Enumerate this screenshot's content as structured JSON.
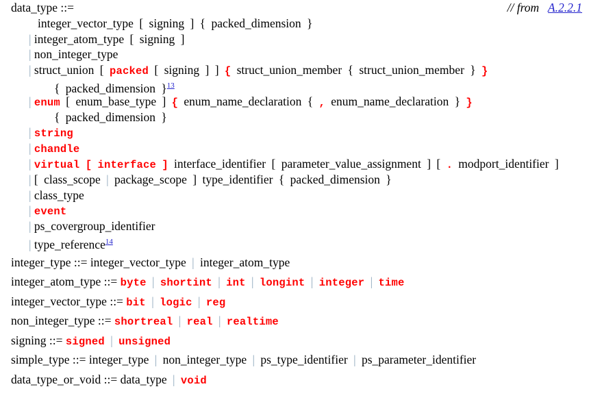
{
  "document": {
    "type": "bnf-grammar",
    "background": "#ffffff",
    "colors": {
      "keyword": "#ff0000",
      "nonterminal": "#000000",
      "alternation_bar": "#8fa8bc",
      "link": "#2222cc"
    }
  },
  "header_note": {
    "comment": "// from",
    "xref": "A.2.2.1"
  },
  "productions": [
    {
      "lhs": "data_type",
      "assign": "::=",
      "alternatives": [
        {
          "bar": "",
          "indent": "first",
          "tokens": [
            {
              "t": "nt",
              "v": "integer_vector_type"
            },
            {
              "t": "meta",
              "v": "["
            },
            {
              "t": "nt",
              "v": "signing"
            },
            {
              "t": "meta",
              "v": "]"
            },
            {
              "t": "meta",
              "v": "{"
            },
            {
              "t": "nt",
              "v": "packed_dimension"
            },
            {
              "t": "meta",
              "v": "}"
            }
          ]
        },
        {
          "bar": "|",
          "indent": "alt",
          "tokens": [
            {
              "t": "nt",
              "v": "integer_atom_type"
            },
            {
              "t": "meta",
              "v": "["
            },
            {
              "t": "nt",
              "v": "signing"
            },
            {
              "t": "meta",
              "v": "]"
            }
          ]
        },
        {
          "bar": "|",
          "indent": "alt",
          "tokens": [
            {
              "t": "nt",
              "v": "non_integer_type"
            }
          ]
        },
        {
          "bar": "|",
          "indent": "alt",
          "tokens": [
            {
              "t": "nt",
              "v": "struct_union"
            },
            {
              "t": "meta",
              "v": "["
            },
            {
              "t": "kw",
              "v": "packed"
            },
            {
              "t": "meta",
              "v": "["
            },
            {
              "t": "nt",
              "v": "signing"
            },
            {
              "t": "meta",
              "v": "]"
            },
            {
              "t": "meta",
              "v": "]"
            },
            {
              "t": "term",
              "v": "{"
            },
            {
              "t": "nt",
              "v": "struct_union_member"
            },
            {
              "t": "meta",
              "v": "{"
            },
            {
              "t": "nt",
              "v": "struct_union_member"
            },
            {
              "t": "meta",
              "v": "}"
            },
            {
              "t": "term",
              "v": "}"
            }
          ]
        },
        {
          "bar": "",
          "indent": "cont",
          "tokens": [
            {
              "t": "meta",
              "v": "{"
            },
            {
              "t": "nt",
              "v": "packed_dimension"
            },
            {
              "t": "meta",
              "v": "}"
            },
            {
              "t": "fn",
              "v": "13"
            }
          ]
        },
        {
          "bar": "|",
          "indent": "alt",
          "tokens": [
            {
              "t": "kw",
              "v": "enum"
            },
            {
              "t": "meta",
              "v": "["
            },
            {
              "t": "nt",
              "v": "enum_base_type"
            },
            {
              "t": "meta",
              "v": "]"
            },
            {
              "t": "term",
              "v": "{"
            },
            {
              "t": "nt",
              "v": "enum_name_declaration"
            },
            {
              "t": "meta",
              "v": "{"
            },
            {
              "t": "term",
              "v": ","
            },
            {
              "t": "nt",
              "v": "enum_name_declaration"
            },
            {
              "t": "meta",
              "v": "}"
            },
            {
              "t": "term",
              "v": "}"
            }
          ]
        },
        {
          "bar": "",
          "indent": "cont",
          "tokens": [
            {
              "t": "meta",
              "v": "{"
            },
            {
              "t": "nt",
              "v": "packed_dimension"
            },
            {
              "t": "meta",
              "v": "}"
            }
          ]
        },
        {
          "bar": "|",
          "indent": "alt",
          "tokens": [
            {
              "t": "kw",
              "v": "string"
            }
          ]
        },
        {
          "bar": "|",
          "indent": "alt",
          "tokens": [
            {
              "t": "kw",
              "v": "chandle"
            }
          ]
        },
        {
          "bar": "|",
          "indent": "alt",
          "tokens": [
            {
              "t": "kw",
              "v": "virtual"
            },
            {
              "t": "term",
              "v": "["
            },
            {
              "t": "kw",
              "v": "interface"
            },
            {
              "t": "term",
              "v": "]"
            },
            {
              "t": "nt",
              "v": "interface_identifier"
            },
            {
              "t": "meta",
              "v": "["
            },
            {
              "t": "nt",
              "v": "parameter_value_assignment"
            },
            {
              "t": "meta",
              "v": "]"
            },
            {
              "t": "meta",
              "v": "["
            },
            {
              "t": "term",
              "v": "."
            },
            {
              "t": "nt",
              "v": "modport_identifier"
            },
            {
              "t": "meta",
              "v": "]"
            }
          ]
        },
        {
          "bar": "|",
          "indent": "alt",
          "tokens": [
            {
              "t": "meta",
              "v": "["
            },
            {
              "t": "nt",
              "v": "class_scope"
            },
            {
              "t": "bar",
              "v": "|"
            },
            {
              "t": "nt",
              "v": "package_scope"
            },
            {
              "t": "meta",
              "v": "]"
            },
            {
              "t": "nt",
              "v": "type_identifier"
            },
            {
              "t": "meta",
              "v": "{"
            },
            {
              "t": "nt",
              "v": "packed_dimension"
            },
            {
              "t": "meta",
              "v": "}"
            }
          ]
        },
        {
          "bar": "|",
          "indent": "alt",
          "tokens": [
            {
              "t": "nt",
              "v": "class_type"
            }
          ]
        },
        {
          "bar": "|",
          "indent": "alt",
          "tokens": [
            {
              "t": "kw",
              "v": "event"
            }
          ]
        },
        {
          "bar": "|",
          "indent": "alt",
          "tokens": [
            {
              "t": "nt",
              "v": "ps_covergroup_identifier"
            }
          ]
        },
        {
          "bar": "|",
          "indent": "alt",
          "tokens": [
            {
              "t": "nt",
              "v": "type_reference"
            },
            {
              "t": "fn",
              "v": "14"
            }
          ]
        }
      ]
    }
  ],
  "simple_productions": [
    {
      "lhs": "integer_type",
      "assign": "::=",
      "tokens": [
        {
          "t": "nt",
          "v": "integer_vector_type"
        },
        {
          "t": "bar",
          "v": "|"
        },
        {
          "t": "nt",
          "v": "integer_atom_type"
        }
      ]
    },
    {
      "lhs": "integer_atom_type",
      "assign": "::=",
      "tokens": [
        {
          "t": "kw",
          "v": "byte"
        },
        {
          "t": "bar",
          "v": "|"
        },
        {
          "t": "kw",
          "v": "shortint"
        },
        {
          "t": "bar",
          "v": "|"
        },
        {
          "t": "kw",
          "v": "int"
        },
        {
          "t": "bar",
          "v": "|"
        },
        {
          "t": "kw",
          "v": "longint"
        },
        {
          "t": "bar",
          "v": "|"
        },
        {
          "t": "kw",
          "v": "integer"
        },
        {
          "t": "bar",
          "v": "|"
        },
        {
          "t": "kw",
          "v": "time"
        }
      ]
    },
    {
      "lhs": "integer_vector_type",
      "assign": "::=",
      "tokens": [
        {
          "t": "kw",
          "v": "bit"
        },
        {
          "t": "bar",
          "v": "|"
        },
        {
          "t": "kw",
          "v": "logic"
        },
        {
          "t": "bar",
          "v": "|"
        },
        {
          "t": "kw",
          "v": "reg"
        }
      ]
    },
    {
      "lhs": "non_integer_type",
      "assign": "::=",
      "tokens": [
        {
          "t": "kw",
          "v": "shortreal"
        },
        {
          "t": "bar",
          "v": "|"
        },
        {
          "t": "kw",
          "v": "real"
        },
        {
          "t": "bar",
          "v": "|"
        },
        {
          "t": "kw",
          "v": "realtime"
        }
      ]
    },
    {
      "lhs": "signing",
      "assign": "::=",
      "tokens": [
        {
          "t": "kw",
          "v": "signed"
        },
        {
          "t": "bar",
          "v": "|"
        },
        {
          "t": "kw",
          "v": "unsigned"
        }
      ]
    },
    {
      "lhs": "simple_type",
      "assign": "::=",
      "tokens": [
        {
          "t": "nt",
          "v": "integer_type"
        },
        {
          "t": "bar",
          "v": "|"
        },
        {
          "t": "nt",
          "v": "non_integer_type"
        },
        {
          "t": "bar",
          "v": "|"
        },
        {
          "t": "nt",
          "v": "ps_type_identifier"
        },
        {
          "t": "bar",
          "v": "|"
        },
        {
          "t": "nt",
          "v": "ps_parameter_identifier"
        }
      ]
    },
    {
      "lhs": "data_type_or_void",
      "assign": "::=",
      "tokens": [
        {
          "t": "nt",
          "v": "data_type"
        },
        {
          "t": "bar",
          "v": "|"
        },
        {
          "t": "kw",
          "v": "void"
        }
      ]
    }
  ]
}
